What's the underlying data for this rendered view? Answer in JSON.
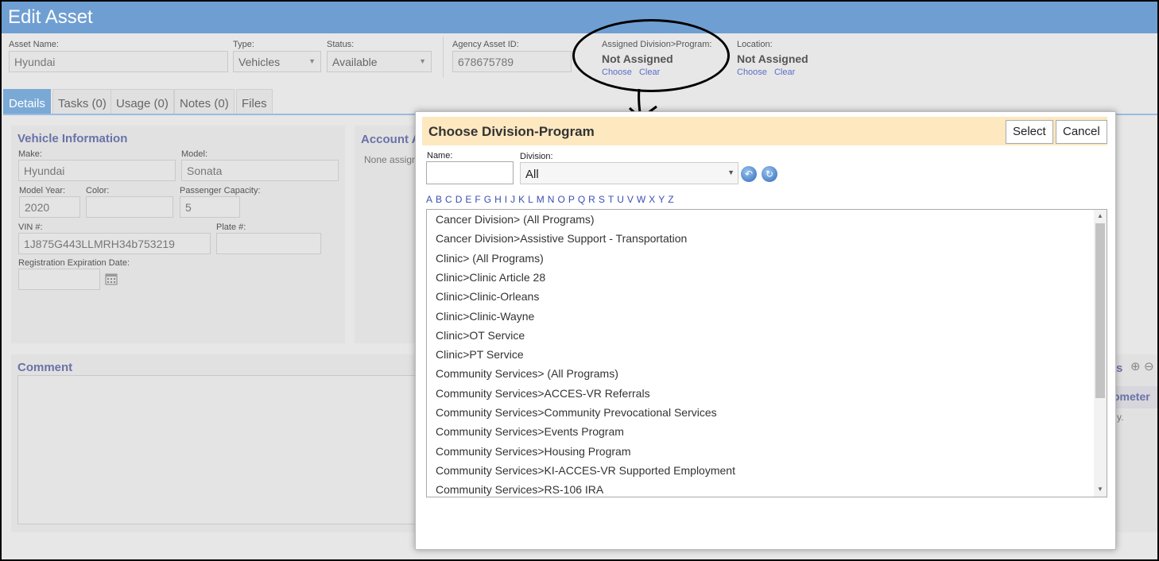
{
  "window": {
    "title": "Edit Asset"
  },
  "asset": {
    "name_label": "Asset Name:",
    "name_value": "Hyundai",
    "type_label": "Type:",
    "type_value": "Vehicles",
    "status_label": "Status:",
    "status_value": "Available",
    "agency_id_label": "Agency Asset ID:",
    "agency_id_value": "678675789",
    "division_label": "Assigned Division>Program:",
    "division_value": "Not Assigned",
    "location_label": "Location:",
    "location_value": "Not Assigned",
    "choose_link": "Choose",
    "clear_link": "Clear"
  },
  "tabs": [
    "Details",
    "Tasks (0)",
    "Usage (0)",
    "Notes (0)",
    "Files"
  ],
  "vehicle": {
    "title": "Vehicle Information",
    "make_label": "Make:",
    "make_value": "Hyundai",
    "model_label": "Model:",
    "model_value": "Sonata",
    "year_label": "Model Year:",
    "year_value": "2020",
    "color_label": "Color:",
    "color_value": "",
    "capacity_label": "Passenger Capacity:",
    "capacity_value": "5",
    "vin_label": "VIN #:",
    "vin_value": "1J875G443LLMRH34b753219",
    "plate_label": "Plate #:",
    "plate_value": "",
    "reg_label": "Registration Expiration Date:",
    "reg_value": ""
  },
  "account": {
    "title": "Account A",
    "none_text": "None assign"
  },
  "comment": {
    "title": "Comment"
  },
  "right_partial": {
    "heading_fragment": "s",
    "col_fragment": "ometer",
    "text_fragment": "y."
  },
  "dialog": {
    "title": "Choose Division-Program",
    "select_label": "Select",
    "cancel_label": "Cancel",
    "name_label": "Name:",
    "name_value": "",
    "division_label": "Division:",
    "division_value": "All",
    "alphabet": [
      "A",
      "B",
      "C",
      "D",
      "E",
      "F",
      "G",
      "H",
      "I",
      "J",
      "K",
      "L",
      "M",
      "N",
      "O",
      "P",
      "Q",
      "R",
      "S",
      "T",
      "U",
      "V",
      "W",
      "X",
      "Y",
      "Z"
    ],
    "items": [
      "Cancer Division> (All Programs)",
      "Cancer Division>Assistive Support - Transportation",
      "Clinic> (All Programs)",
      "Clinic>Clinic Article 28",
      "Clinic>Clinic-Orleans",
      "Clinic>Clinic-Wayne",
      "Clinic>OT Service",
      "Clinic>PT Service",
      "Community Services> (All Programs)",
      "Community Services>ACCES-VR Referrals",
      "Community Services>Community Prevocational Services",
      "Community Services>Events Program",
      "Community Services>Housing Program",
      "Community Services>KI-ACCES-VR Supported Employment",
      "Community Services>RS-106 IRA"
    ]
  },
  "colors": {
    "header": "#6f9fd2",
    "dialog_header": "#fde8c0",
    "link": "#3a4fb0",
    "section_title": "#6a72a8"
  }
}
